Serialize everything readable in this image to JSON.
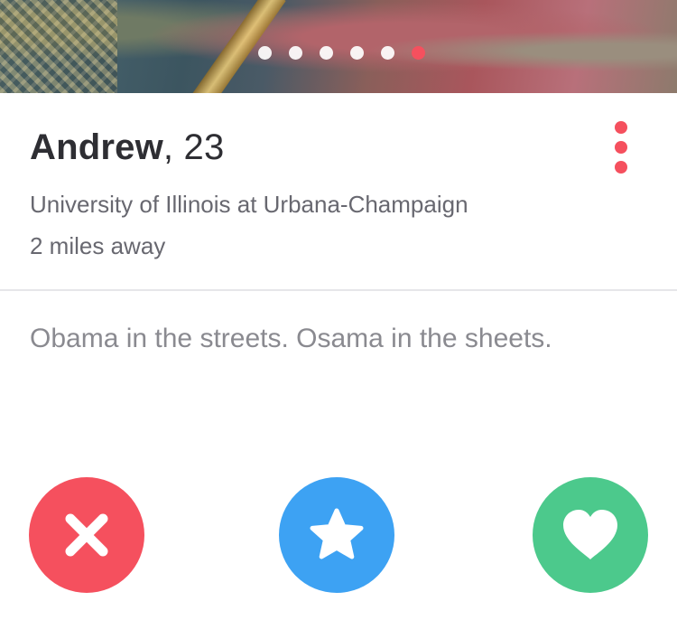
{
  "profile": {
    "name": "Andrew",
    "age": ", 23",
    "school": "University of Illinois at Urbana-Champaign",
    "distance": "2 miles away",
    "bio": "Obama in the streets. Osama in the sheets."
  },
  "photo": {
    "total_photos": 6,
    "active_photo_index": 6
  },
  "colors": {
    "accent": "#f5505e",
    "nope": "#f5505e",
    "super_like": "#3da2f3",
    "like": "#4cc98c",
    "divider": "#e6e6e9"
  },
  "icons": {
    "more": "vertical-ellipsis-icon",
    "nope": "close-icon",
    "super_like": "star-icon",
    "like": "heart-icon"
  }
}
